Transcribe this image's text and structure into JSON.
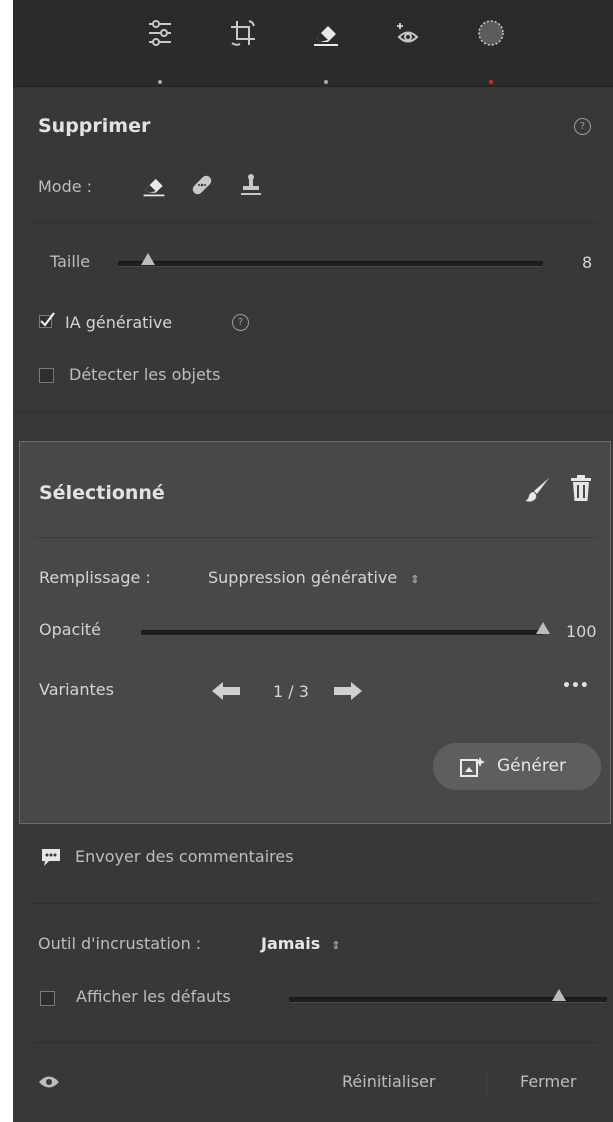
{
  "toolbar": {
    "tools": [
      {
        "icon": "sliders-icon",
        "active": false
      },
      {
        "icon": "crop-rotate-icon",
        "active": false
      },
      {
        "icon": "eraser-icon",
        "active": true
      },
      {
        "icon": "red-eye-icon",
        "active": false
      },
      {
        "icon": "masking-icon",
        "active": false
      }
    ],
    "indicator_color": "#e0222a"
  },
  "remove": {
    "title": "Supprimer",
    "help": "?",
    "mode_label": "Mode :",
    "mode_icons": [
      "eraser-icon",
      "healing-bandage-icon",
      "clone-stamp-icon"
    ],
    "size_label": "Taille",
    "size_value": "8",
    "size_fraction": 0.07,
    "generative_ai_label": "IA générative",
    "generative_ai_checked": true,
    "detect_objects_label": "Détecter les objets",
    "detect_objects_checked": false
  },
  "selected": {
    "title": "Sélectionné",
    "fill_label": "Remplissage :",
    "fill_value": "Suppression générative",
    "opacity_label": "Opacité",
    "opacity_value": "100",
    "opacity_fraction": 1.0,
    "variants_label": "Variantes",
    "variants_counter": "1 / 3",
    "more": "•••",
    "generate_label": "Générer"
  },
  "feedback": {
    "label": "Envoyer des commentaires"
  },
  "overlay": {
    "label": "Outil d'incrustation :",
    "value": "Jamais",
    "show_defaults_label": "Afficher les défauts",
    "show_defaults_checked": false,
    "slider_fraction": 0.85
  },
  "footer": {
    "reset_label": "Réinitialiser",
    "close_label": "Fermer"
  }
}
